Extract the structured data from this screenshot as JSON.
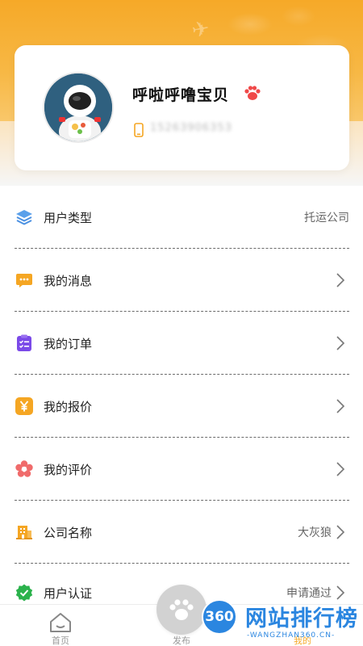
{
  "profile": {
    "nickname": "呼啦呼噜宝贝",
    "phone": "15263906353"
  },
  "menu": [
    {
      "label": "用户类型",
      "value": "托运公司",
      "icon": "layers-icon",
      "icon_color": "#4a90e2",
      "chevron": false
    },
    {
      "label": "我的消息",
      "value": "",
      "icon": "message-icon",
      "icon_color": "#f5a623",
      "chevron": true
    },
    {
      "label": "我的订单",
      "value": "",
      "icon": "clipboard-icon",
      "icon_color": "#7b4ae8",
      "chevron": true
    },
    {
      "label": "我的报价",
      "value": "",
      "icon": "yen-icon",
      "icon_color": "#f5a623",
      "chevron": true
    },
    {
      "label": "我的评价",
      "value": "",
      "icon": "flower-icon",
      "icon_color": "#f06b6b",
      "chevron": true
    },
    {
      "label": "公司名称",
      "value": "大灰狼",
      "icon": "building-icon",
      "icon_color": "#f5a623",
      "chevron": true
    },
    {
      "label": "用户认证",
      "value": "申请通过",
      "icon": "verified-icon",
      "icon_color": "#2bb24c",
      "chevron": true
    }
  ],
  "tabbar": {
    "home": "首页",
    "publish": "发布",
    "mine": "我的"
  },
  "watermark": {
    "logo": "360",
    "title": "网站排行榜",
    "subtitle": "-WANGZHAN360.CN-"
  },
  "colors": {
    "accent": "#f6a928",
    "watermark": "#2b86e0"
  }
}
